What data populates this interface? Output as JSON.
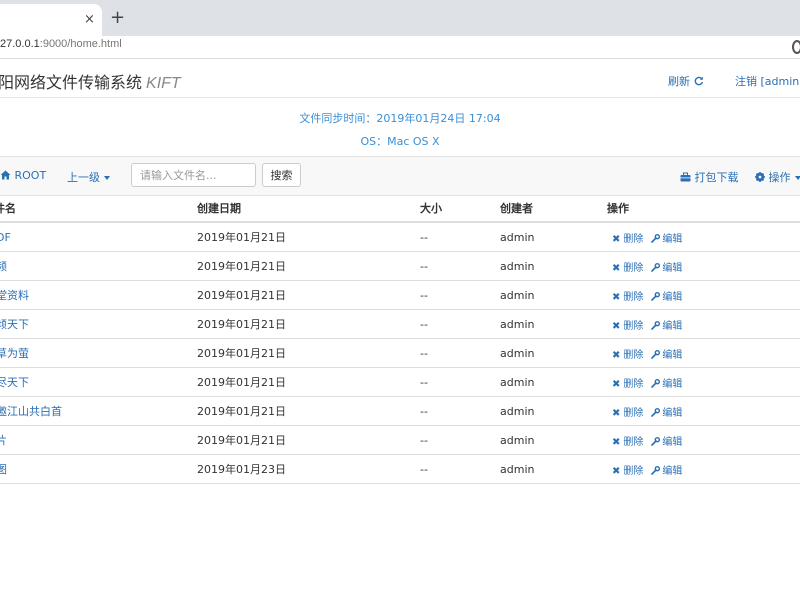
{
  "browser": {
    "tab_close": "×",
    "new_tab": "+",
    "url_host": "27.0.0.1",
    "url_rest": ":9000/home.html"
  },
  "header": {
    "title": "阳网络文件传输系统",
    "brand": "KIFT",
    "refresh_label": "刷新",
    "logout_label": "注销 [admin]"
  },
  "info": {
    "sync_time": "文件同步时间：2019年01月24日 17:04",
    "os": "OS：Mac OS X"
  },
  "toolbar": {
    "root_label": "ROOT",
    "parent_label": "上一级",
    "search_placeholder": "请输入文件名...",
    "search_button": "搜索",
    "pack_download": "打包下载",
    "operations": "操作"
  },
  "table": {
    "headers": {
      "name": "件名",
      "date": "创建日期",
      "size": "大小",
      "creator": "创建者",
      "actions": "操作"
    },
    "action_delete": "删除",
    "action_edit": "编辑",
    "rows": [
      {
        "name": "DF",
        "date": "2019年01月21日",
        "size": "--",
        "creator": "admin"
      },
      {
        "name": "频",
        "date": "2019年01月21日",
        "size": "--",
        "creator": "admin"
      },
      {
        "name": "堂资料",
        "date": "2019年01月21日",
        "size": "--",
        "creator": "admin"
      },
      {
        "name": "倾天下",
        "date": "2019年01月21日",
        "size": "--",
        "creator": "admin"
      },
      {
        "name": "草为萤",
        "date": "2019年01月21日",
        "size": "--",
        "creator": "admin"
      },
      {
        "name": "尽天下",
        "date": "2019年01月21日",
        "size": "--",
        "creator": "admin"
      },
      {
        "name": "邀江山共白首",
        "date": "2019年01月21日",
        "size": "--",
        "creator": "admin"
      },
      {
        "name": "片",
        "date": "2019年01月21日",
        "size": "--",
        "creator": "admin"
      },
      {
        "name": "图",
        "date": "2019年01月23日",
        "size": "--",
        "creator": "admin"
      }
    ]
  },
  "colors": {
    "link": "#2a6fb5",
    "info": "#3a8fd6",
    "toolbar_bg": "#f8f8f8"
  },
  "icons": [
    "home-icon",
    "refresh-icon",
    "briefcase-icon",
    "gear-icon",
    "delete-x-icon",
    "wrench-icon"
  ]
}
